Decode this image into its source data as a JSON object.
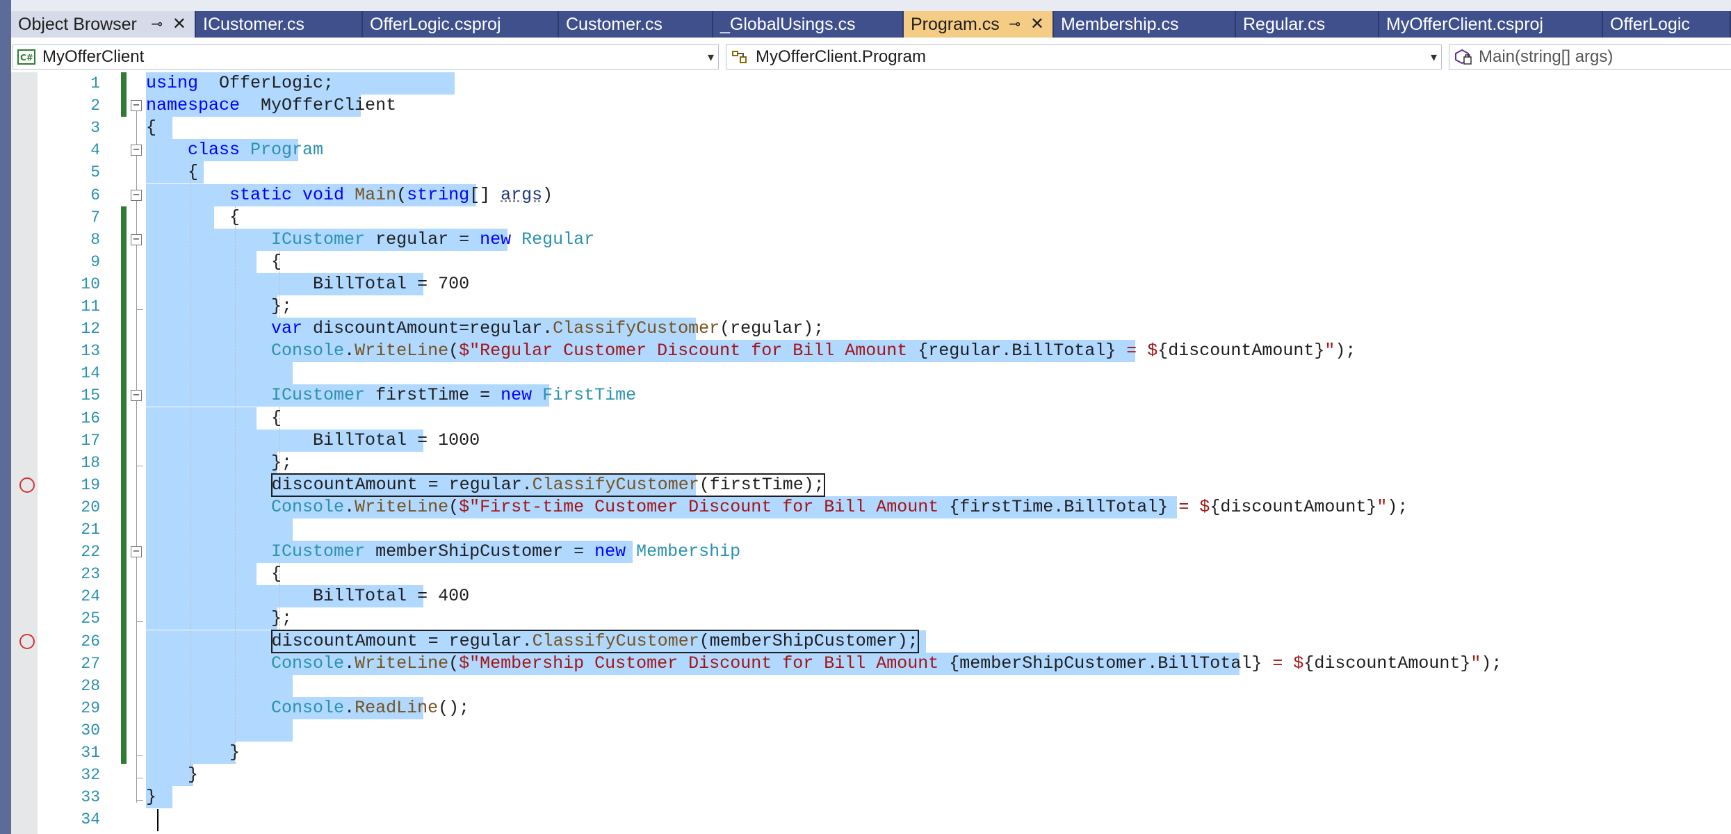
{
  "tabs": [
    {
      "label": "Object Browser",
      "pinned": true,
      "closable": true,
      "style": "pinned"
    },
    {
      "label": "ICustomer.cs"
    },
    {
      "label": "OfferLogic.csproj"
    },
    {
      "label": "Customer.cs"
    },
    {
      "label": "_GlobalUsings.cs"
    },
    {
      "label": "Program.cs",
      "pinned": true,
      "closable": true,
      "style": "active"
    },
    {
      "label": "Membership.cs"
    },
    {
      "label": "Regular.cs"
    },
    {
      "label": "MyOfferClient.csproj"
    },
    {
      "label": "OfferLogic"
    }
  ],
  "icons": {
    "pin": "pin-icon",
    "close": "close-icon"
  },
  "nav": {
    "project": {
      "label": "MyOfferClient",
      "icon": "csharp-project-icon"
    },
    "type": {
      "label": "MyOfferClient.Program",
      "icon": "class-icon"
    },
    "member": {
      "label": "Main(string[] args)",
      "icon": "method-icon"
    }
  },
  "editor": {
    "breakpoint_lines": [
      19,
      26
    ],
    "lines": [
      {
        "n": "1",
        "code": [
          [
            "kw",
            "using"
          ],
          [
            "",
            "  OfferLogic;"
          ]
        ]
      },
      {
        "n": "2",
        "code": [
          [
            "kw",
            "namespace"
          ],
          [
            "",
            "  MyOfferClient"
          ]
        ]
      },
      {
        "n": "3",
        "code": [
          [
            "",
            "{"
          ]
        ]
      },
      {
        "n": "4",
        "code": [
          [
            "",
            "    "
          ],
          [
            "kw",
            "class"
          ],
          [
            "",
            ""
          ],
          [
            "ty",
            " Program"
          ]
        ]
      },
      {
        "n": "5",
        "code": [
          [
            "",
            "    {"
          ]
        ]
      },
      {
        "n": "6",
        "code": [
          [
            "",
            "        "
          ],
          [
            "kw",
            "static"
          ],
          [
            "",
            ""
          ],
          [
            "kw",
            " void"
          ],
          [
            "",
            ""
          ],
          [
            "fn",
            " Main"
          ],
          [
            "",
            "("
          ],
          [
            "kw",
            "string"
          ],
          [
            "",
            "[] "
          ],
          [
            "pm",
            "args"
          ],
          [
            "",
            ")"
          ]
        ]
      },
      {
        "n": "7",
        "code": [
          [
            "",
            "        {"
          ]
        ]
      },
      {
        "n": "8",
        "code": [
          [
            "",
            "            "
          ],
          [
            "ty",
            "ICustomer"
          ],
          [
            "",
            " regular = "
          ],
          [
            "kw",
            "new"
          ],
          [
            "ty",
            " Regular"
          ]
        ]
      },
      {
        "n": "9",
        "code": [
          [
            "",
            "            {"
          ]
        ]
      },
      {
        "n": "10",
        "code": [
          [
            "",
            "                BillTotal = 700"
          ]
        ]
      },
      {
        "n": "11",
        "code": [
          [
            "",
            "            };"
          ]
        ]
      },
      {
        "n": "12",
        "code": [
          [
            "",
            "            "
          ],
          [
            "kw",
            "var"
          ],
          [
            "",
            " discountAmount=regular."
          ],
          [
            "fn",
            "ClassifyCustomer"
          ],
          [
            "",
            "(regular);"
          ]
        ]
      },
      {
        "n": "13",
        "code": [
          [
            "",
            "            "
          ],
          [
            "ty",
            "Console"
          ],
          [
            "",
            "."
          ],
          [
            "fn",
            "WriteLine"
          ],
          [
            "",
            "("
          ],
          [
            "st",
            "$\"Regular Customer Discount for Bill Amount "
          ],
          [
            "",
            "{regular.BillTotal}"
          ],
          [
            "st",
            " = $"
          ],
          [
            "",
            "{discountAmount}"
          ],
          [
            "st",
            "\""
          ],
          [
            "",
            ");"
          ]
        ]
      },
      {
        "n": "14",
        "code": []
      },
      {
        "n": "15",
        "code": [
          [
            "",
            "            "
          ],
          [
            "ty",
            "ICustomer"
          ],
          [
            "",
            " firstTime = "
          ],
          [
            "kw",
            "new"
          ],
          [
            "ty",
            " FirstTime"
          ]
        ]
      },
      {
        "n": "16",
        "code": [
          [
            "",
            "            {"
          ]
        ]
      },
      {
        "n": "17",
        "code": [
          [
            "",
            "                BillTotal = 1000"
          ]
        ]
      },
      {
        "n": "18",
        "code": [
          [
            "",
            "            };"
          ]
        ]
      },
      {
        "n": "19",
        "code": [
          [
            "",
            "            discountAmount = regular."
          ],
          [
            "fn",
            "ClassifyCustomer"
          ],
          [
            "",
            "(firstTime);"
          ]
        ]
      },
      {
        "n": "20",
        "code": [
          [
            "",
            "            "
          ],
          [
            "ty",
            "Console"
          ],
          [
            "",
            "."
          ],
          [
            "fn",
            "WriteLine"
          ],
          [
            "",
            "("
          ],
          [
            "st",
            "$\"First-time Customer Discount for Bill Amount "
          ],
          [
            "",
            "{firstTime.BillTotal}"
          ],
          [
            "st",
            " = $"
          ],
          [
            "",
            "{discountAmount}"
          ],
          [
            "st",
            "\""
          ],
          [
            "",
            ");"
          ]
        ]
      },
      {
        "n": "21",
        "code": []
      },
      {
        "n": "22",
        "code": [
          [
            "",
            "            "
          ],
          [
            "ty",
            "ICustomer"
          ],
          [
            "",
            " memberShipCustomer = "
          ],
          [
            "kw",
            "new"
          ],
          [
            "ty",
            " Membership"
          ]
        ]
      },
      {
        "n": "23",
        "code": [
          [
            "",
            "            {"
          ]
        ]
      },
      {
        "n": "24",
        "code": [
          [
            "",
            "                BillTotal = 400"
          ]
        ]
      },
      {
        "n": "25",
        "code": [
          [
            "",
            "            };"
          ]
        ]
      },
      {
        "n": "26",
        "code": [
          [
            "",
            "            discountAmount = regular."
          ],
          [
            "fn",
            "ClassifyCustomer"
          ],
          [
            "",
            "(memberShipCustomer);"
          ]
        ]
      },
      {
        "n": "27",
        "code": [
          [
            "",
            "            "
          ],
          [
            "ty",
            "Console"
          ],
          [
            "",
            "."
          ],
          [
            "fn",
            "WriteLine"
          ],
          [
            "",
            "("
          ],
          [
            "st",
            "$\"Membership Customer Discount for Bill Amount "
          ],
          [
            "",
            "{memberShipCustomer.BillTotal}"
          ],
          [
            "st",
            " = $"
          ],
          [
            "",
            "{discountAmount}"
          ],
          [
            "st",
            "\""
          ],
          [
            "",
            ");"
          ]
        ]
      },
      {
        "n": "28",
        "code": []
      },
      {
        "n": "29",
        "code": [
          [
            "",
            "            "
          ],
          [
            "ty",
            "Console"
          ],
          [
            "",
            "."
          ],
          [
            "fn",
            "ReadLine"
          ],
          [
            "",
            "();"
          ]
        ]
      },
      {
        "n": "30",
        "code": []
      },
      {
        "n": "31",
        "code": [
          [
            "",
            "        }"
          ]
        ]
      },
      {
        "n": "32",
        "code": [
          [
            "",
            "    }"
          ]
        ]
      },
      {
        "n": "33",
        "code": [
          [
            "",
            "}"
          ]
        ]
      },
      {
        "n": "34",
        "code": []
      }
    ]
  }
}
